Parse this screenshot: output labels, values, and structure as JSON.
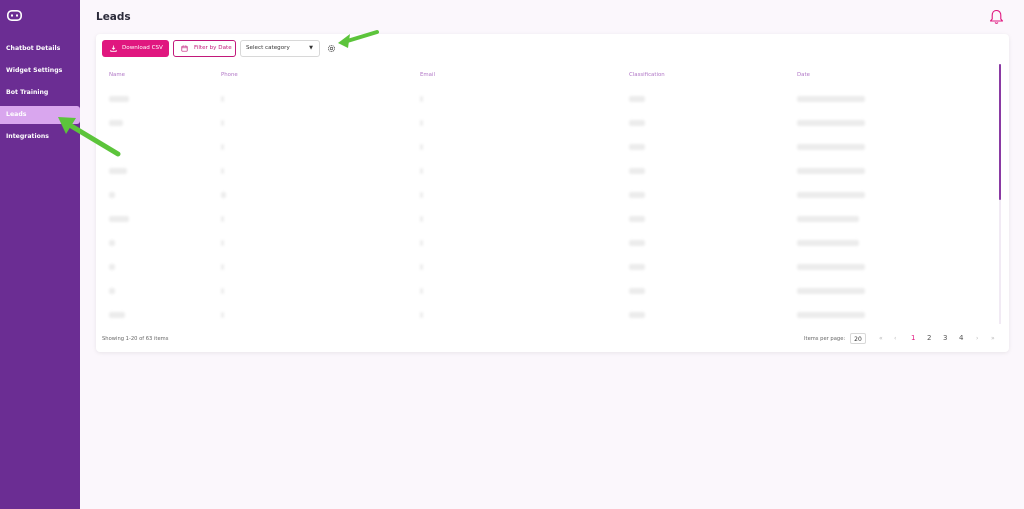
{
  "page": {
    "title": "Leads"
  },
  "sidebar": {
    "items": [
      {
        "label": "Chatbot Details"
      },
      {
        "label": "Widget Settings"
      },
      {
        "label": "Bot Training"
      },
      {
        "label": "Leads"
      },
      {
        "label": "Integrations"
      }
    ]
  },
  "toolbar": {
    "download_label": "Download CSV",
    "filter_label": "Filter by Date",
    "select_value": "Select category"
  },
  "table": {
    "columns": [
      "Name",
      "Phone",
      "Email",
      "Classification",
      "Date"
    ]
  },
  "footer": {
    "showing": "Showing 1-20 of 63 items",
    "items_per_page_label": "Items per page:",
    "items_per_page_value": "20",
    "pages": [
      "1",
      "2",
      "3",
      "4"
    ],
    "first": "«",
    "prev": "‹",
    "next": "›",
    "last": "»"
  },
  "colors": {
    "sidebar": "#6b2d93",
    "accent": "#e0177f",
    "active_nav": "#d9a6ee",
    "annotation_arrow": "#5cc43b"
  },
  "icons": [
    "logo-icon",
    "bell-icon",
    "download-icon",
    "calendar-icon",
    "gear-icon",
    "arrow-annotation"
  ]
}
